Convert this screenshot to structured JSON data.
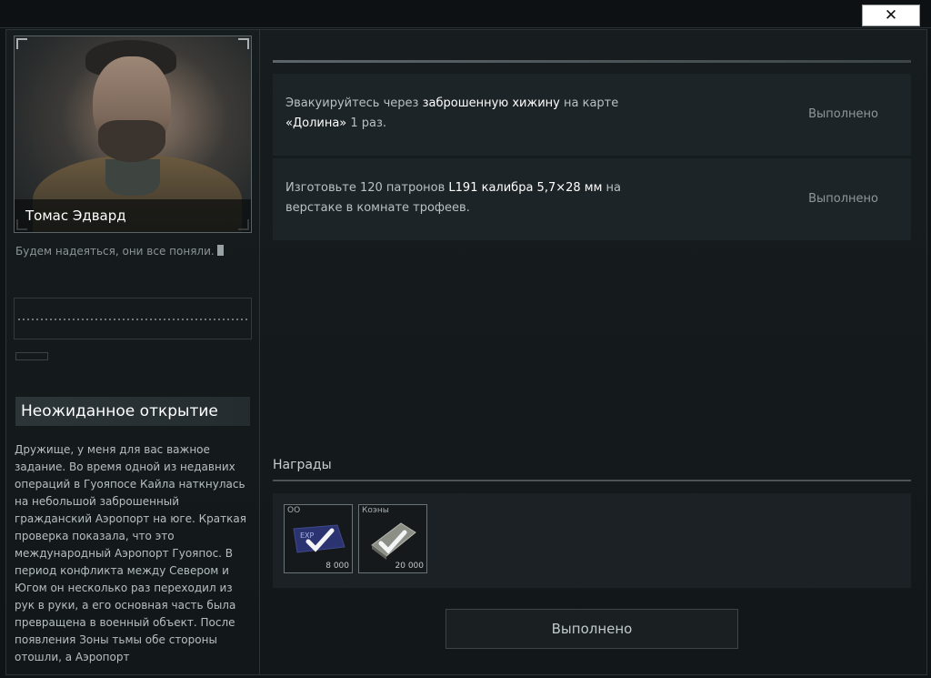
{
  "window": {
    "close_label": "✕"
  },
  "trader": {
    "name": "Томас Эдвард",
    "quote": "Будем надеяться, они все поняли."
  },
  "quest": {
    "title": "Неожиданное открытие",
    "description": "Дружище, у меня для вас важное задание. Во время одной из недавних операций в Гуояпосе Кайла наткнулась на небольшой заброшенный гражданский Аэропорт на юге. Краткая проверка показала, что это международный Аэропорт Гуояпос. В период конфликта между Севером и Югом он несколько раз переходил из рук в руки, а его основная часть была превращена в военный объект. После появления Зоны тьмы обе стороны отошли, а Аэропорт"
  },
  "objectives": [
    {
      "parts": [
        {
          "text": "Эвакуируйтесь через ",
          "highlight": false
        },
        {
          "text": "заброшенную хижину",
          "highlight": true
        },
        {
          "text": " на карте ",
          "highlight": false
        },
        {
          "text": "«Долина»",
          "highlight": true
        },
        {
          "text": " 1 раз.",
          "highlight": false
        }
      ],
      "status": "Выполнено"
    },
    {
      "parts": [
        {
          "text": "Изготовьте 120 патронов ",
          "highlight": false
        },
        {
          "text": "L191 калибра 5,7×28 мм",
          "highlight": true
        },
        {
          "text": " на верстаке в комнате трофеев.",
          "highlight": false
        }
      ],
      "status": "Выполнено"
    }
  ],
  "rewards": {
    "label": "Награды",
    "items": [
      {
        "name": "ОО",
        "count": "8 000",
        "icon": "experience-icon",
        "badge": "EXP"
      },
      {
        "name": "Коэны",
        "count": "20 000",
        "icon": "coins-icon"
      }
    ]
  },
  "complete_button": "Выполнено",
  "colors": {
    "highlight": "#ffffff",
    "background": "#0f1416",
    "panel": "#1d2427"
  }
}
